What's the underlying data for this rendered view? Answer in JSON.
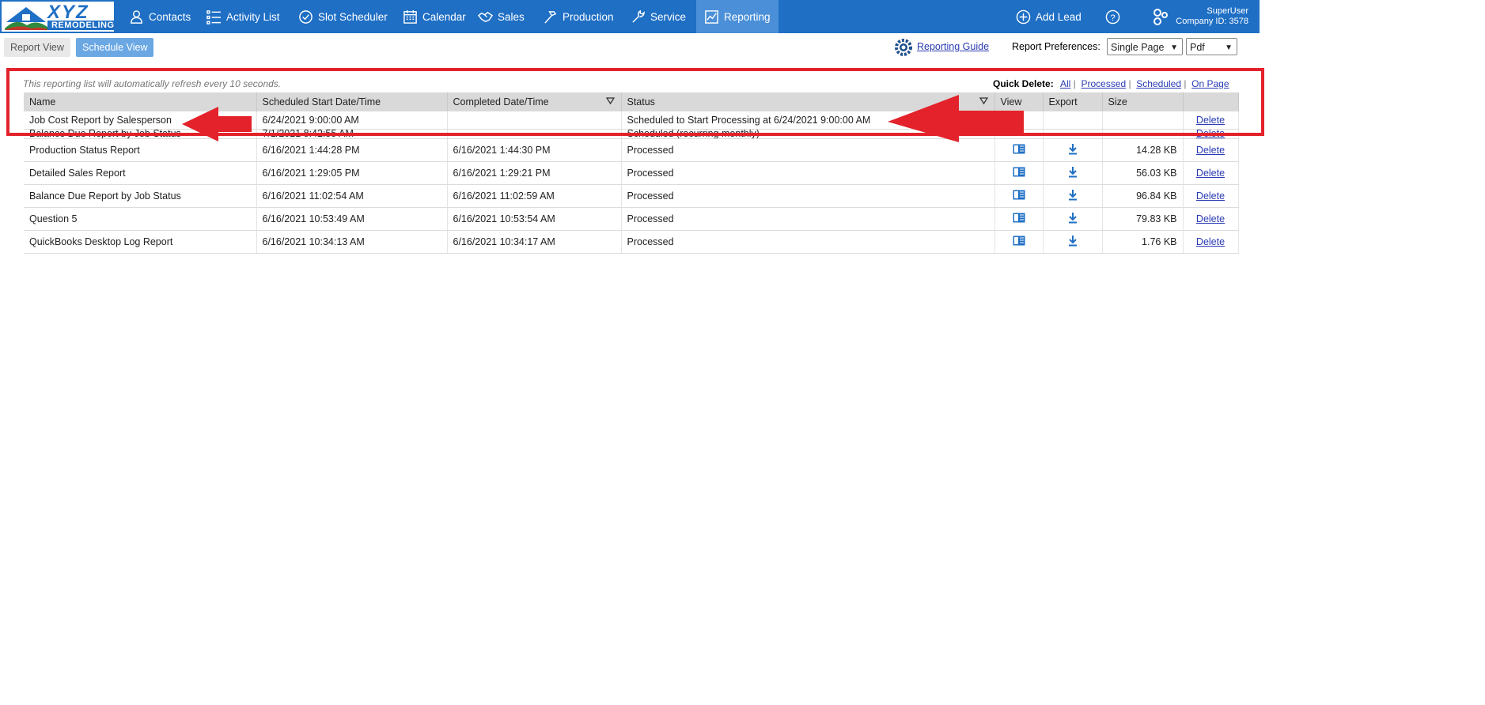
{
  "brand": {
    "name": "XYZ",
    "tagline": "REMODELING"
  },
  "nav": {
    "items": [
      {
        "label": "Contacts",
        "icon": "person-icon"
      },
      {
        "label": "Activity List",
        "icon": "list-icon"
      },
      {
        "label": "Slot Scheduler",
        "icon": "check-circle-icon"
      },
      {
        "label": "Calendar",
        "icon": "calendar-icon"
      },
      {
        "label": "Sales",
        "icon": "handshake-icon"
      },
      {
        "label": "Production",
        "icon": "hammer-icon"
      },
      {
        "label": "Service",
        "icon": "wrench-icon"
      },
      {
        "label": "Reporting",
        "icon": "chart-icon",
        "active": true
      }
    ],
    "add_lead": "Add Lead",
    "help": "?",
    "user": {
      "name": "SuperUser",
      "company": "Company ID: 3578"
    }
  },
  "toolbar": {
    "report_view": "Report View",
    "schedule_view": "Schedule View",
    "guide": "Reporting Guide",
    "prefs_label": "Report Preferences:",
    "page_mode": "Single Page",
    "format": "Pdf"
  },
  "list": {
    "refresh_note": "This reporting list will automatically refresh every 10 seconds.",
    "quick_delete": {
      "label": "Quick Delete:",
      "all": "All",
      "processed": "Processed",
      "scheduled": "Scheduled",
      "on_page": "On Page"
    },
    "columns": {
      "name": "Name",
      "start": "Scheduled Start Date/Time",
      "completed": "Completed Date/Time",
      "status": "Status",
      "view": "View",
      "export": "Export",
      "size": "Size"
    },
    "delete_label": "Delete",
    "rows": [
      {
        "name": "Job Cost Report by Salesperson",
        "start": "6/24/2021 9:00:00 AM",
        "completed": "",
        "status": "Scheduled to Start Processing at 6/24/2021 9:00:00 AM",
        "size": ""
      },
      {
        "name": "Balance Due Report by Job Status",
        "start": "7/1/2021 8:42:55 AM",
        "completed": "",
        "status": "Scheduled (recurring monthly)",
        "size": ""
      },
      {
        "name": "Production Status Report",
        "start": "6/16/2021 1:44:28 PM",
        "completed": "6/16/2021 1:44:30 PM",
        "status": "Processed",
        "size": "14.28 KB"
      },
      {
        "name": "Detailed Sales Report",
        "start": "6/16/2021 1:29:05 PM",
        "completed": "6/16/2021 1:29:21 PM",
        "status": "Processed",
        "size": "56.03 KB"
      },
      {
        "name": "Balance Due Report by Job Status",
        "start": "6/16/2021 11:02:54 AM",
        "completed": "6/16/2021 11:02:59 AM",
        "status": "Processed",
        "size": "96.84 KB"
      },
      {
        "name": "Question 5",
        "start": "6/16/2021 10:53:49 AM",
        "completed": "6/16/2021 10:53:54 AM",
        "status": "Processed",
        "size": "79.83 KB"
      },
      {
        "name": "QuickBooks Desktop Log Report",
        "start": "6/16/2021 10:34:13 AM",
        "completed": "6/16/2021 10:34:17 AM",
        "status": "Processed",
        "size": "1.76 KB"
      }
    ]
  },
  "colors": {
    "nav_bg": "#1f6fc5",
    "highlight": "#e3222b",
    "link": "#2a3bb3"
  }
}
